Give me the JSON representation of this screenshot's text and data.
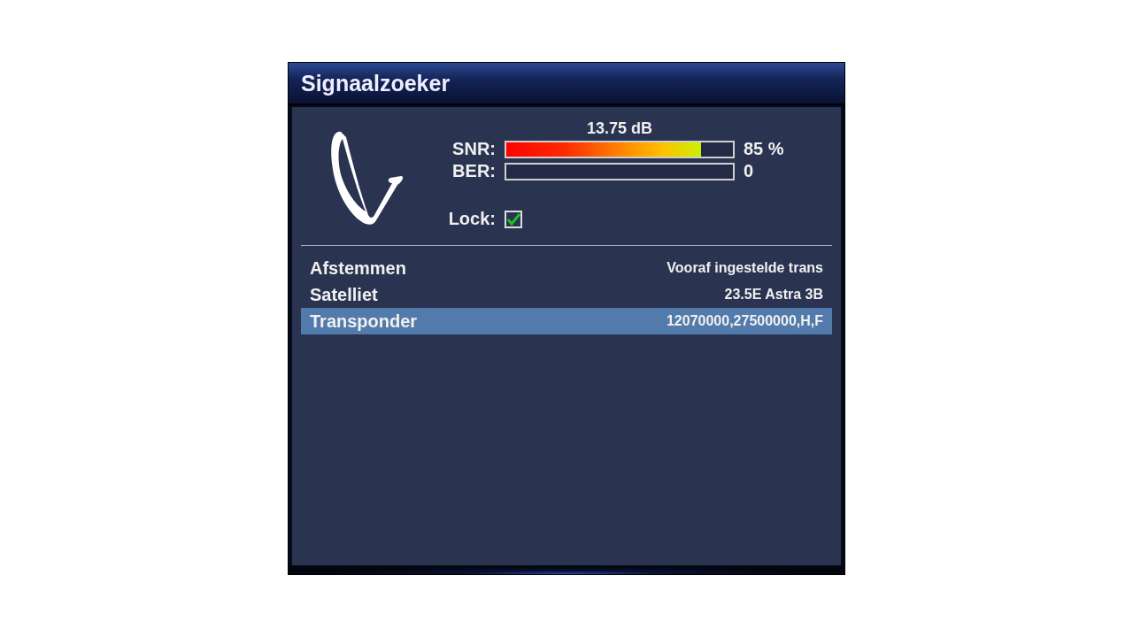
{
  "window": {
    "title": "Signaalzoeker"
  },
  "signal": {
    "reading": "13.75 dB",
    "meters": [
      {
        "label": "SNR:",
        "level": 0.86,
        "value": "85 %"
      },
      {
        "label": "BER:",
        "value": "0"
      }
    ],
    "lock": {
      "label": "Lock:",
      "checked": true
    }
  },
  "menu": [
    {
      "label": "Afstemmen",
      "value": "Vooraf ingestelde trans",
      "selected": false
    },
    {
      "label": "Satelliet",
      "value": "23.5E Astra 3B",
      "selected": false
    },
    {
      "label": "Transponder",
      "value": "12070000,27500000,H,F",
      "selected": true
    }
  ]
}
